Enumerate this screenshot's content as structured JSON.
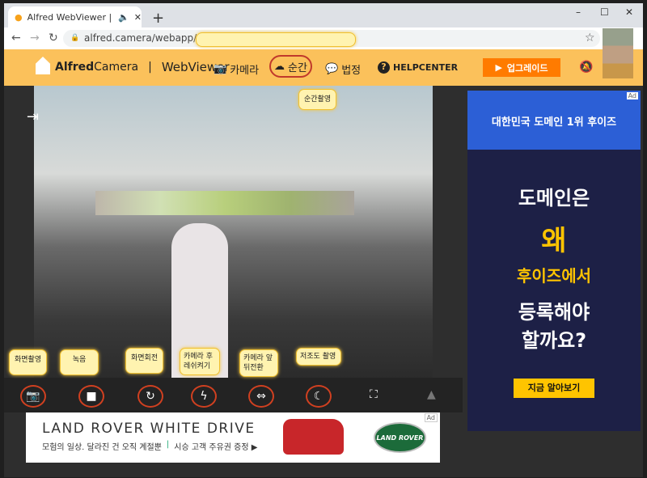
{
  "browser": {
    "tab_title": "Alfred WebViewer | Monitor",
    "url": "alfred.camera/webapp/camera/",
    "new_tab": "+",
    "window_controls": [
      "–",
      "☐",
      "✕"
    ]
  },
  "header": {
    "brand_bold": "Alfred",
    "brand_light": "Camera",
    "separator": "|",
    "product": "WebViewer",
    "nav": [
      {
        "label": "카메라"
      },
      {
        "label": "순간"
      },
      {
        "label": "법정"
      },
      {
        "label": "HELPCENTER"
      }
    ],
    "upgrade": "업그레이드"
  },
  "tooltips": {
    "moment": "순간촬영",
    "snapshot": "화면촬영",
    "record": "녹음",
    "rotate": "화면회전",
    "flash": "카메라 후레쉬켜기",
    "switch": "카메라 앞뒤전환",
    "lowlight": "저조도 촬영"
  },
  "banner_ad": {
    "badge": "Ad",
    "title": "LAND ROVER WHITE DRIVE",
    "subtitle": "모험의 일상. 달라진 건 오직 계절뿐",
    "cta": "시승 고객 주유권 증정 ▶",
    "logo": "LAND ROVER"
  },
  "side_ad": {
    "badge": "Ad",
    "top": "대한민국 도메인 1위 후이즈",
    "line1": "도메인은",
    "line2": "왜",
    "line3": "후이즈에서",
    "line4": "등록해야",
    "line5": "할까요?",
    "button": "지금 알아보기"
  }
}
